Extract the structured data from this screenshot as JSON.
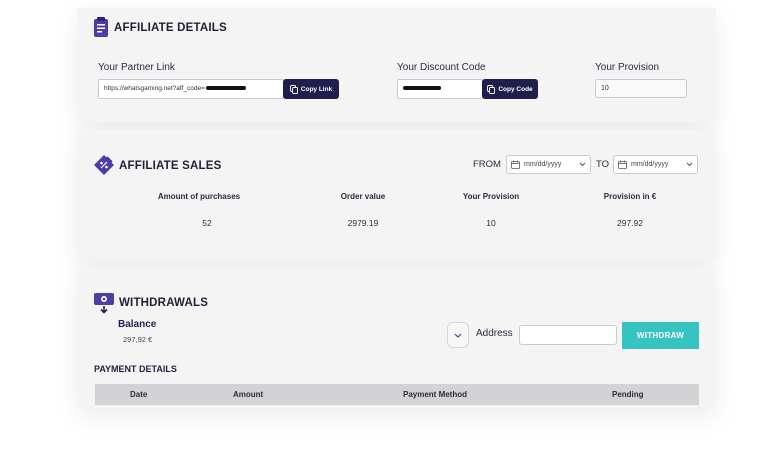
{
  "affiliate_details": {
    "title": "AFFILIATE DETAILS",
    "partner_link_label": "Your Partner Link",
    "partner_link_value": "https://whatsgaming.net?aff_code=",
    "copy_link_label": "Copy Link",
    "discount_code_label": "Your Discount Code",
    "copy_code_label": "Copy Code",
    "provision_label": "Your Provision",
    "provision_value": "10"
  },
  "affiliate_sales": {
    "title": "AFFILIATE SALES",
    "from_label": "FROM",
    "to_label": "TO",
    "date_placeholder_from": "mm/dd/yyyy",
    "date_placeholder_to": "mm/dd/yyyy",
    "columns": [
      "Amount of purchases",
      "Order value",
      "Your Provision",
      "Provision in €"
    ],
    "values": [
      "52",
      "2979.19",
      "10",
      "297.92"
    ]
  },
  "withdrawals": {
    "title": "WITHDRAWALS",
    "balance_label": "Balance",
    "balance_value": "297,92 €",
    "address_label": "Address",
    "address_value": "",
    "withdraw_label": "WITHDRAW",
    "payment_details_title": "PAYMENT DETAILS",
    "table_headers": [
      "Date",
      "Amount",
      "Payment Method",
      "Pending"
    ]
  },
  "colors": {
    "accent_dark": "#1f1f4f",
    "accent_teal": "#36c3c1",
    "icon_purple": "#4b3ca8"
  }
}
